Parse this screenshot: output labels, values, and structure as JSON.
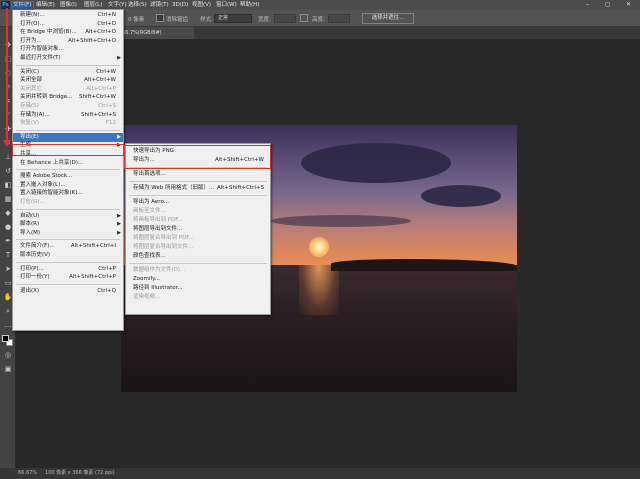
{
  "menubar": {
    "app_logo": "Ps",
    "items": [
      "文件(F)",
      "编辑(E)",
      "图像(I)",
      "图层(L)",
      "文字(Y)",
      "选择(S)",
      "滤镜(T)",
      "3D(D)",
      "视图(V)",
      "窗口(W)",
      "帮助(H)"
    ],
    "window_controls": "– ◻ ✕"
  },
  "options_bar": {
    "feather_label": "0 像素",
    "antialias_label": "消除锯齿",
    "style_label": "样式:",
    "style_value": "正常",
    "width_label": "宽度:",
    "height_label": "高度:",
    "subject_button": "选择并遮住..."
  },
  "document_tab": {
    "label": "66.7%(RGB/8#)"
  },
  "file_menu": {
    "items": [
      {
        "label": "新建(N)...",
        "shortcut": "Ctrl+N",
        "enabled": true
      },
      {
        "label": "打开(O)...",
        "shortcut": "Ctrl+O",
        "enabled": true
      },
      {
        "label": "在 Bridge 中浏览(B)...",
        "shortcut": "Alt+Ctrl+O",
        "enabled": true
      },
      {
        "label": "打开为...",
        "shortcut": "Alt+Shift+Ctrl+O",
        "enabled": true
      },
      {
        "label": "打开为智能对象...",
        "shortcut": "",
        "enabled": true
      },
      {
        "label": "最近打开文件(T)",
        "shortcut": "",
        "enabled": true,
        "submenu": true
      },
      {
        "sep": true
      },
      {
        "label": "关闭(C)",
        "shortcut": "Ctrl+W",
        "enabled": true
      },
      {
        "label": "关闭全部",
        "shortcut": "Alt+Ctrl+W",
        "enabled": true
      },
      {
        "label": "关闭其它",
        "shortcut": "Alt+Ctrl+P",
        "enabled": false
      },
      {
        "label": "关闭并转到 Bridge...",
        "shortcut": "Shift+Ctrl+W",
        "enabled": true
      },
      {
        "label": "存储(S)",
        "shortcut": "Ctrl+S",
        "enabled": false
      },
      {
        "label": "存储为(A)...",
        "shortcut": "Shift+Ctrl+S",
        "enabled": true
      },
      {
        "label": "恢复(V)",
        "shortcut": "F12",
        "enabled": false
      },
      {
        "sep": true
      },
      {
        "label": "导出(E)",
        "shortcut": "",
        "enabled": true,
        "submenu": true,
        "highlighted": true
      },
      {
        "label": "生成",
        "shortcut": "",
        "enabled": true,
        "submenu": true
      },
      {
        "label": "共享...",
        "shortcut": "",
        "enabled": true
      },
      {
        "label": "在 Behance 上共享(D)...",
        "shortcut": "",
        "enabled": true
      },
      {
        "sep": true
      },
      {
        "label": "搜索 Adobe Stock...",
        "shortcut": "",
        "enabled": true
      },
      {
        "label": "置入嵌入对象(L)...",
        "shortcut": "",
        "enabled": true
      },
      {
        "label": "置入链接的智能对象(K)...",
        "shortcut": "",
        "enabled": true
      },
      {
        "label": "打包(G)...",
        "shortcut": "",
        "enabled": false
      },
      {
        "sep": true
      },
      {
        "label": "自动(U)",
        "shortcut": "",
        "enabled": true,
        "submenu": true
      },
      {
        "label": "脚本(R)",
        "shortcut": "",
        "enabled": true,
        "submenu": true
      },
      {
        "label": "导入(M)",
        "shortcut": "",
        "enabled": true,
        "submenu": true
      },
      {
        "sep": true
      },
      {
        "label": "文件简介(F)...",
        "shortcut": "Alt+Shift+Ctrl+I",
        "enabled": true
      },
      {
        "label": "版本历史(V)",
        "shortcut": "",
        "enabled": true
      },
      {
        "sep": true
      },
      {
        "label": "打印(P)...",
        "shortcut": "Ctrl+P",
        "enabled": true
      },
      {
        "label": "打印一份(Y)",
        "shortcut": "Alt+Shift+Ctrl+P",
        "enabled": true
      },
      {
        "sep": true
      },
      {
        "label": "退出(X)",
        "shortcut": "Ctrl+Q",
        "enabled": true
      }
    ]
  },
  "export_menu": {
    "items": [
      {
        "label": "快速导出为 PNG",
        "shortcut": "",
        "enabled": true
      },
      {
        "label": "导出为...",
        "shortcut": "Alt+Shift+Ctrl+W",
        "enabled": true
      },
      {
        "sep": true
      },
      {
        "label": "导出首选项...",
        "shortcut": "",
        "enabled": true
      },
      {
        "sep": true
      },
      {
        "label": "存储为 Web 所用格式（旧版）...",
        "shortcut": "Alt+Shift+Ctrl+S",
        "enabled": true
      },
      {
        "sep": true
      },
      {
        "label": "导出为 Aero...",
        "shortcut": "",
        "enabled": true
      },
      {
        "label": "画板至文件...",
        "shortcut": "",
        "enabled": false
      },
      {
        "label": "将画板导出到 PDF...",
        "shortcut": "",
        "enabled": false
      },
      {
        "label": "将图层导出到文件...",
        "shortcut": "",
        "enabled": true
      },
      {
        "label": "将图层复合导出到 PDF...",
        "shortcut": "",
        "enabled": false
      },
      {
        "label": "将图层复合导出到文件...",
        "shortcut": "",
        "enabled": false
      },
      {
        "label": "颜色查找表...",
        "shortcut": "",
        "enabled": true
      },
      {
        "sep": true
      },
      {
        "label": "数据组作为文件(D)...",
        "shortcut": "",
        "enabled": false
      },
      {
        "label": "Zoomify...",
        "shortcut": "",
        "enabled": true
      },
      {
        "label": "路径到 Illustrator...",
        "shortcut": "",
        "enabled": true
      },
      {
        "label": "渲染视频...",
        "shortcut": "",
        "enabled": false
      }
    ]
  },
  "status_bar": {
    "zoom": "66.67%",
    "doc_info": "100 像素 x 366 像素 (72 ppi)"
  },
  "colors": {
    "highlight": "#3a78c4",
    "annotation": "#e0322b",
    "menu_bg": "#f0f0f0"
  }
}
